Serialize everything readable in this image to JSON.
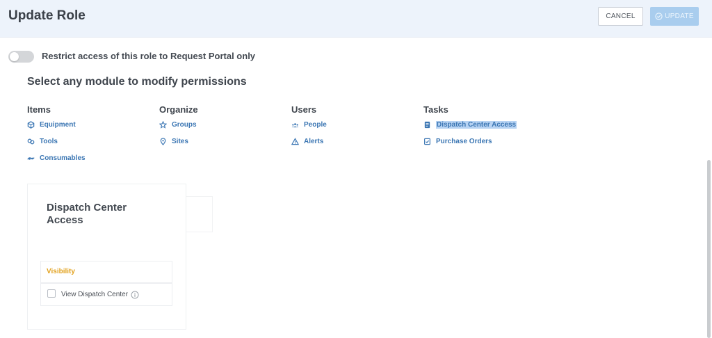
{
  "header": {
    "title": "Update Role",
    "cancel_label": "CANCEL",
    "update_label": "UPDATE"
  },
  "restrict": {
    "label": "Restrict access of this role to Request Portal only",
    "enabled": false
  },
  "section_title": "Select any module to modify permissions",
  "modules": [
    {
      "heading": "Items",
      "items": [
        {
          "label": "Equipment",
          "icon": "cube-icon"
        },
        {
          "label": "Tools",
          "icon": "tools-icon"
        },
        {
          "label": "Consumables",
          "icon": "consumables-icon"
        }
      ]
    },
    {
      "heading": "Organize",
      "items": [
        {
          "label": "Groups",
          "icon": "star-icon"
        },
        {
          "label": "Sites",
          "icon": "location-pin-icon"
        }
      ]
    },
    {
      "heading": "Users",
      "items": [
        {
          "label": "People",
          "icon": "people-icon"
        },
        {
          "label": "Alerts",
          "icon": "warning-icon"
        }
      ]
    },
    {
      "heading": "Tasks",
      "items": [
        {
          "label": "Dispatch Center Access",
          "icon": "document-icon",
          "selected": true
        },
        {
          "label": "Purchase Orders",
          "icon": "checklist-icon"
        }
      ]
    }
  ],
  "panel": {
    "title": "Dispatch Center Access",
    "visibility_label": "Visibility",
    "permission_label": "View Dispatch Center",
    "permission_checked": false
  },
  "colors": {
    "accent": "#3b76b3",
    "visibility": "#e2a21f",
    "header_bg": "#edf3fb",
    "update_btn": "#a9cdee"
  }
}
